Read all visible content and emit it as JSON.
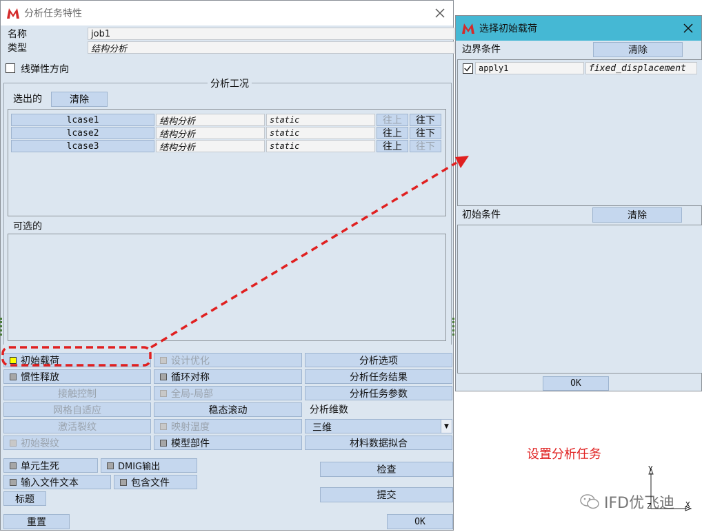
{
  "job_dialog": {
    "title": "分析任务特性",
    "name_label": "名称",
    "name_value": "job1",
    "type_label": "类型",
    "type_value": "结构分析",
    "linear_elastic_label": "线弹性方向",
    "analysis_cases_title": "分析工况",
    "selected_label": "选出的",
    "clear_label": "清除",
    "available_label": "可选的",
    "cases": [
      {
        "name": "lcase1",
        "type": "结构分析",
        "mode": "static",
        "up": "往上",
        "down": "往下"
      },
      {
        "name": "lcase2",
        "type": "结构分析",
        "mode": "static",
        "up": "往上",
        "down": "往下"
      },
      {
        "name": "lcase3",
        "type": "结构分析",
        "mode": "static",
        "up": "往上",
        "down": "往下"
      }
    ],
    "buttons": {
      "initial_loads": "初始载荷",
      "design_opt": "设计优化",
      "analysis_options": "分析选项",
      "inertia_relief": "惯性释放",
      "cyclic_symmetry": "循环对称",
      "job_results": "分析任务结果",
      "contact_control": "接触控制",
      "global_local": "全局-局部",
      "job_parameters": "分析任务参数",
      "mesh_adaptivity": "网格自适应",
      "steady_rolling": "稳态滚动",
      "analysis_dimension_label": "分析维数",
      "activate_cracks": "激活裂纹",
      "radiation_temp": "映射温度",
      "dimension_value": "三维",
      "initial_cracks": "初始裂纹",
      "model_parts": "模型部件",
      "material_fitting": "材料数据拟合",
      "element_death": "单元生死",
      "dmig_output": "DMIG输出",
      "input_file_text": "输入文件文本",
      "include_file": "包含文件",
      "title_btn": "标题",
      "check": "检查",
      "submit": "提交",
      "reset": "重置",
      "ok": "OK"
    }
  },
  "initial_loads_dialog": {
    "title": "选择初始载荷",
    "boundary_label": "边界条件",
    "clear_label": "清除",
    "boundary_items": [
      {
        "name": "apply1",
        "type": "fixed_displacement",
        "checked": true
      }
    ],
    "initial_label": "初始条件",
    "ok": "OK"
  },
  "annotation": {
    "caption": "设置分析任务",
    "accent_color": "#e02020"
  },
  "watermark": {
    "text": "IFD优飞迪",
    "axis_y": "Y",
    "axis_z": "Z",
    "axis_x": "X"
  },
  "colors": {
    "window_bg": "#dce6f0",
    "button_bg": "#c5d7ee",
    "titlebar_active": "#45b8d4"
  }
}
